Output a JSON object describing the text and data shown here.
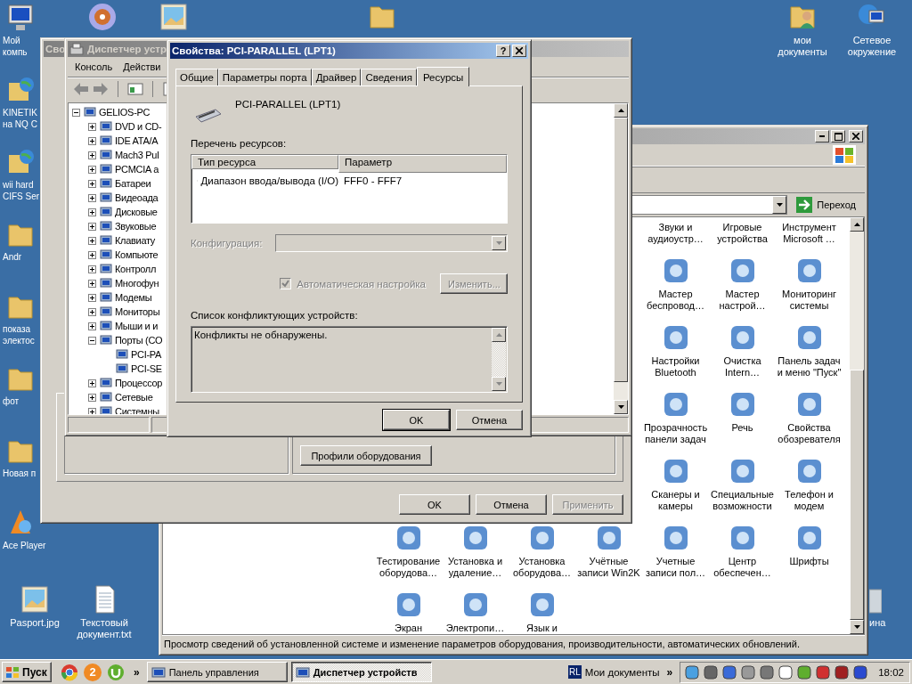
{
  "desktop": {
    "left_icons": [
      {
        "label": "Мой\nкомпь",
        "kind": "computer"
      },
      {
        "label": "KINETIK\nна NQ C",
        "kind": "globe"
      },
      {
        "label": "wii hard\nCIFS Ser",
        "kind": "globe"
      },
      {
        "label": "Andr",
        "kind": "folder"
      },
      {
        "label": "показа\nэлектос",
        "kind": "folder"
      },
      {
        "label": "фот",
        "kind": "folder"
      },
      {
        "label": "Новая п",
        "kind": "folder"
      },
      {
        "label": "Ace Player",
        "kind": "player"
      }
    ],
    "top_icons": [
      {
        "kind": "disc"
      },
      {
        "kind": "picture"
      },
      {
        "kind": "folder"
      }
    ],
    "right_icons": [
      {
        "label": "мои\nдокументы",
        "kind": "folder"
      },
      {
        "label": "Сетевое\nокружение",
        "kind": "globe"
      }
    ],
    "bottom_icons": [
      {
        "label": "Pasport.jpg",
        "kind": "picture"
      },
      {
        "label": "Текстовый\nдокумент.txt",
        "kind": "document"
      }
    ],
    "recycle_bin": {
      "label": "ина"
    }
  },
  "control_panel": {
    "go_button": "Переход",
    "icons_right": [
      {
        "label": "Звуки и\nаудиоустр…"
      },
      {
        "label": "Игровые\nустройства"
      },
      {
        "label": "Инструмент\nMicrosoft …"
      },
      {
        "label": "Мастер\nбеспровод…"
      },
      {
        "label": "Мастер\nнастрой…"
      },
      {
        "label": "Мониторинг\nсистемы"
      },
      {
        "label": "Настройки\nBluetooth"
      },
      {
        "label": "Очистка\nIntern…"
      },
      {
        "label": "Панель задач\nи меню \"Пуск\""
      },
      {
        "label": "Прозрачность\nпанели задач"
      },
      {
        "label": "Речь"
      },
      {
        "label": "Свойства\nобозревателя"
      },
      {
        "label": "Сканеры и\nкамеры"
      },
      {
        "label": "Специальные\nвозможности"
      },
      {
        "label": "Телефон и\nмодем"
      }
    ],
    "icons_bottom": [
      {
        "label": "Тестирование\nоборудова…"
      },
      {
        "label": "Установка и\nудаление…"
      },
      {
        "label": "Установка\nоборудова…"
      },
      {
        "label": "Учётные\nзаписи Win2K"
      },
      {
        "label": "Учетные\nзаписи пол…"
      },
      {
        "label": "Центр\nобеспечен…"
      },
      {
        "label": "Шрифты"
      },
      {
        "label": "Экран"
      },
      {
        "label": "Электропи…"
      },
      {
        "label": "Язык и"
      }
    ],
    "status": "Просмотр сведений об установленной системе и изменение параметров оборудования, производительности, автоматических обновлений."
  },
  "system_properties": {
    "title": "Сво",
    "profiles_button": "Профили оборудования",
    "buttons": [
      {
        "label": "OK",
        "disabled": false
      },
      {
        "label": "Отмена",
        "disabled": false
      },
      {
        "label": "Применить",
        "disabled": true
      }
    ]
  },
  "device_manager": {
    "title": "Диспетчер устр",
    "menu": [
      "Консоль",
      "Действи"
    ],
    "tree": {
      "label": "GELIOS-PC",
      "expanded": true,
      "children": [
        {
          "label": "DVD и CD-",
          "expanded": false
        },
        {
          "label": "IDE ATA/A",
          "expanded": false
        },
        {
          "label": "Mach3 Pul",
          "expanded": false
        },
        {
          "label": "PCMCIA a",
          "expanded": false
        },
        {
          "label": "Батареи",
          "expanded": false
        },
        {
          "label": "Видеоада",
          "expanded": false
        },
        {
          "label": "Дисковые",
          "expanded": false
        },
        {
          "label": "Звуковые",
          "expanded": false
        },
        {
          "label": "Клавиату",
          "expanded": false
        },
        {
          "label": "Компьюте",
          "expanded": false
        },
        {
          "label": "Контролл",
          "expanded": false
        },
        {
          "label": "Многофун",
          "expanded": false
        },
        {
          "label": "Модемы",
          "expanded": false
        },
        {
          "label": "Мониторы",
          "expanded": false
        },
        {
          "label": "Мыши и и",
          "expanded": false
        },
        {
          "label": "Порты (CO",
          "expanded": true,
          "children": [
            {
              "label": "PCI-PA"
            },
            {
              "label": "PCI-SE"
            }
          ]
        },
        {
          "label": "Процессор",
          "expanded": false
        },
        {
          "label": "Сетевые",
          "expanded": false
        },
        {
          "label": "Системны",
          "expanded": false
        }
      ]
    }
  },
  "dialog": {
    "title": "Свойства: PCI-PARALLEL (LPT1)",
    "help_button": "?",
    "tabs": [
      {
        "label": "Общие",
        "selected": false
      },
      {
        "label": "Параметры порта",
        "selected": false
      },
      {
        "label": "Драйвер",
        "selected": false
      },
      {
        "label": "Сведения",
        "selected": false
      },
      {
        "label": "Ресурсы",
        "selected": true
      }
    ],
    "device_name": "PCI-PARALLEL (LPT1)",
    "resources_label": "Перечень ресурсов:",
    "columns": [
      "Тип ресурса",
      "Параметр"
    ],
    "rows": [
      {
        "type": "Диапазон ввода/вывода (I/O)",
        "setting": "FFF0 - FFF7"
      }
    ],
    "config": {
      "label": "Конфигурация:",
      "disabled": true
    },
    "auto_settings": {
      "label": "Автоматическая настройка",
      "checked": true,
      "disabled": true
    },
    "change_button": {
      "label": "Изменить...",
      "disabled": true
    },
    "conflicts_label": "Список конфликтующих устройств:",
    "conflicts_text": "Конфликты не обнаружены.",
    "buttons": [
      {
        "label": "OK"
      },
      {
        "label": "Отмена"
      }
    ]
  },
  "taskbar": {
    "start": "Пуск",
    "quick_badge": "2",
    "more": "»",
    "tasks": [
      {
        "label": "Панель управления",
        "selected": false
      },
      {
        "label": "Диспетчер устройств",
        "selected": true
      }
    ],
    "toolbar_badge": "RL",
    "toolbar_label": "Мои документы",
    "toolbar_more": "»",
    "clock": "18:02"
  }
}
